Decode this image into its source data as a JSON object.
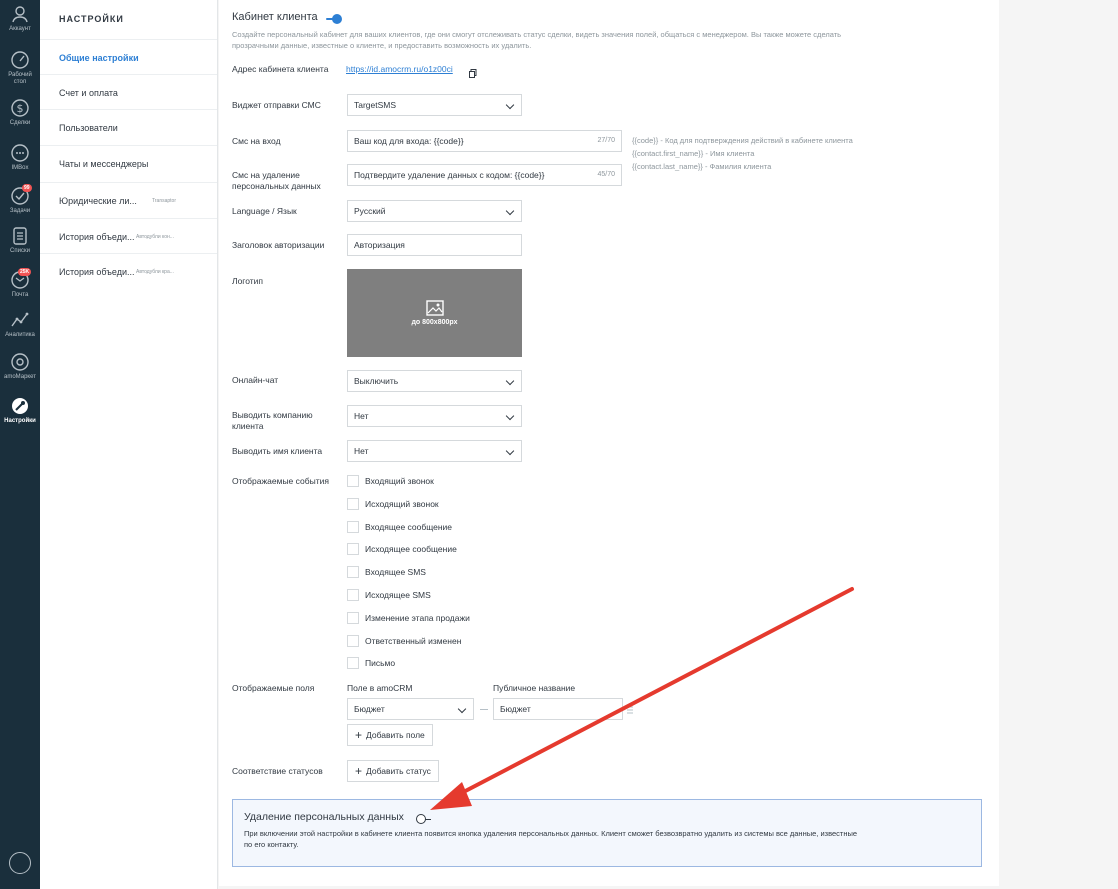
{
  "rail": {
    "items": [
      {
        "label": "Аккаунт"
      },
      {
        "label": "Рабочий стол"
      },
      {
        "label": "Сделки"
      },
      {
        "label": "IMBox"
      },
      {
        "label": "Задачи",
        "badge": "99"
      },
      {
        "label": "Списки"
      },
      {
        "label": "Почта",
        "badge": "25K"
      },
      {
        "label": "Аналитика"
      },
      {
        "label": "amoМаркет"
      },
      {
        "label": "Настройки"
      }
    ]
  },
  "settings_nav": {
    "title": "НАСТРОЙКИ",
    "items": [
      {
        "label": "Общие настройки",
        "sub": ""
      },
      {
        "label": "Счет и оплата",
        "sub": ""
      },
      {
        "label": "Пользователи",
        "sub": ""
      },
      {
        "label": "Чаты и мессенджеры",
        "sub": ""
      },
      {
        "label": "Юридические ли...",
        "sub": "Transaptor"
      },
      {
        "label": "История объеди...",
        "sub": "Автодубли кон..."
      },
      {
        "label": "История объеди...",
        "sub": "Автодубли кра..."
      }
    ]
  },
  "cabinet": {
    "title": "Кабинет клиента",
    "description_line1": "Создайте персональный кабинет для ваших клиентов, где они смогут отслеживать статус сделки, видеть значения полей, общаться с менеджером. Вы также можете сделать",
    "description_line2": "прозрачными данные, известные о клиенте, и предоставить возможность их удалить.",
    "address_label": "Адрес кабинета клиента",
    "address_value": "https://id.amocrm.ru/o1z00ci",
    "sms_widget_label": "Виджет отправки СМС",
    "sms_widget_value": "TargetSMS",
    "sms_login_label": "Смс на вход",
    "sms_login_value": "Ваш код для входа: {{code}}",
    "sms_login_counter": "27/70",
    "sms_delete_label_1": "Смс на удаление",
    "sms_delete_label_2": "персональных данных",
    "sms_delete_value": "Подтвердите удаление данных с кодом: {{code}}",
    "sms_delete_counter": "45/70",
    "hints": [
      "{{code}} - Код для подтверждения действий в кабинете клиента",
      "{{contact.first_name}} - Имя клиента",
      "{{contact.last_name}} - Фамилия клиента"
    ],
    "language_label": "Language / Язык",
    "language_value": "Русский",
    "auth_title_label": "Заголовок авторизации",
    "auth_title_value": "Авторизация",
    "logo_label": "Логотип",
    "logo_hint": "до 800x800px",
    "chat_label": "Онлайн-чат",
    "chat_value": "Выключить",
    "company_label_1": "Выводить компанию",
    "company_label_2": "клиента",
    "company_value": "Нет",
    "name_label": "Выводить имя клиента",
    "name_value": "Нет",
    "events_label": "Отображаемые события",
    "events": [
      "Входящий звонок",
      "Исходящий звонок",
      "Входящее сообщение",
      "Исходящее сообщение",
      "Входящее SMS",
      "Исходящее SMS",
      "Изменение этапа продажи",
      "Ответственный изменен",
      "Письмо"
    ],
    "fields_label": "Отображаемые поля",
    "field_amo_header": "Поле в amoCRM",
    "field_public_header": "Публичное название",
    "field_amo_value": "Бюджет",
    "field_public_value": "Бюджет",
    "add_field_label": "Добавить поле",
    "statuses_label": "Соответствие статусов",
    "add_status_label": "Добавить статус"
  },
  "gdpr": {
    "title": "Удаление персональных данных",
    "description_line1": "При включении этой настройки в кабинете клиента появится кнопка удаления персональных данных. Клиент сможет безвозвратно удалить из системы все данные, известные",
    "description_line2": "по его контакту."
  },
  "colors": {
    "rail": "#1a2f3c",
    "accent": "#2d7fd4",
    "annotation_arrow": "#e53a2e"
  }
}
